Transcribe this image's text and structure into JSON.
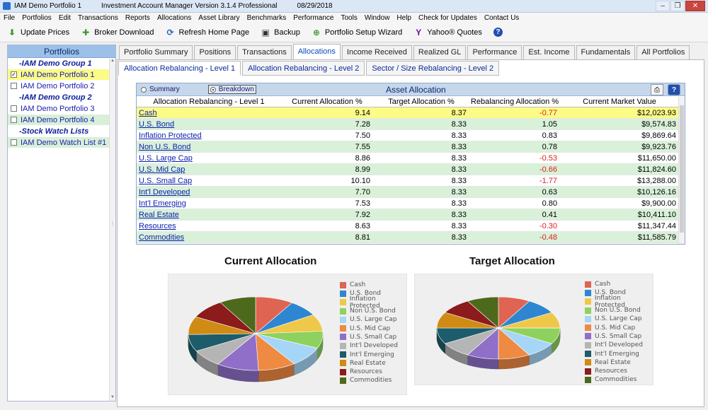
{
  "window": {
    "app_name": "IAM Demo Portfolio 1",
    "product": "Investment Account Manager Version 3.1.4 Professional",
    "date": "08/29/2018"
  },
  "menu": [
    "File",
    "Portfolios",
    "Edit",
    "Transactions",
    "Reports",
    "Allocations",
    "Asset Library",
    "Benchmarks",
    "Performance",
    "Tools",
    "Window",
    "Help",
    "Check for Updates",
    "Contact Us"
  ],
  "toolbar": {
    "update_prices": "Update Prices",
    "broker_download": "Broker Download",
    "refresh_home": "Refresh Home Page",
    "backup": "Backup",
    "setup_wizard": "Portfolio Setup Wizard",
    "yahoo_quotes": "Yahoo® Quotes"
  },
  "portfolios": {
    "title": "Portfolios",
    "items": [
      {
        "label": "-IAM Demo Group 1",
        "type": "group"
      },
      {
        "label": "IAM Demo Portfolio 1",
        "type": "item",
        "checked": true
      },
      {
        "label": "IAM Demo Portfolio 2",
        "type": "item",
        "checked": false
      },
      {
        "label": "-IAM Demo Group 2",
        "type": "group"
      },
      {
        "label": "IAM Demo Portfolio 3",
        "type": "item",
        "checked": false
      },
      {
        "label": "IAM Demo Portfolio 4",
        "type": "item",
        "checked": false
      },
      {
        "label": "-Stock Watch Lists",
        "type": "group"
      },
      {
        "label": "IAM Demo Watch List #1",
        "type": "item",
        "checked": false
      }
    ]
  },
  "main_tabs": [
    "Portfolio Summary",
    "Positions",
    "Transactions",
    "Allocations",
    "Income Received",
    "Realized GL",
    "Performance",
    "Est. Income",
    "Fundamentals",
    "All Portfolios"
  ],
  "sub_tabs": [
    "Allocation Rebalancing - Level 1",
    "Allocation Rebalancing - Level 2",
    "Sector / Size Rebalancing - Level 2"
  ],
  "asset_allocation": {
    "title": "Asset Allocation",
    "radio_summary": "Summary",
    "radio_breakdown": "Breakdown",
    "columns": [
      "Allocation Rebalancing - Level 1",
      "Current Allocation %",
      "Target Allocation %",
      "Rebalancing Allocation %",
      "Current Market Value"
    ],
    "rows": [
      {
        "name": "Cash",
        "current": "9.14",
        "target": "8.37",
        "rebal": "-0.77",
        "value": "$12,023.93"
      },
      {
        "name": "U.S. Bond",
        "current": "7.28",
        "target": "8.33",
        "rebal": "1.05",
        "value": "$9,574.83"
      },
      {
        "name": "Inflation Protected",
        "current": "7.50",
        "target": "8.33",
        "rebal": "0.83",
        "value": "$9,869.64"
      },
      {
        "name": "Non U.S. Bond",
        "current": "7.55",
        "target": "8.33",
        "rebal": "0.78",
        "value": "$9,923.76"
      },
      {
        "name": "U.S. Large Cap",
        "current": "8.86",
        "target": "8.33",
        "rebal": "-0.53",
        "value": "$11,650.00"
      },
      {
        "name": "U.S. Mid Cap",
        "current": "8.99",
        "target": "8.33",
        "rebal": "-0.66",
        "value": "$11,824.60"
      },
      {
        "name": "U.S. Small Cap",
        "current": "10.10",
        "target": "8.33",
        "rebal": "-1.77",
        "value": "$13,288.00"
      },
      {
        "name": "Int'l Developed",
        "current": "7.70",
        "target": "8.33",
        "rebal": "0.63",
        "value": "$10,126.16"
      },
      {
        "name": "Int'l Emerging",
        "current": "7.53",
        "target": "8.33",
        "rebal": "0.80",
        "value": "$9,900.00"
      },
      {
        "name": "Real Estate",
        "current": "7.92",
        "target": "8.33",
        "rebal": "0.41",
        "value": "$10,411.10"
      },
      {
        "name": "Resources",
        "current": "8.63",
        "target": "8.33",
        "rebal": "-0.30",
        "value": "$11,347.44"
      },
      {
        "name": "Commodities",
        "current": "8.81",
        "target": "8.33",
        "rebal": "-0.48",
        "value": "$11,585.79"
      }
    ]
  },
  "chart_data": [
    {
      "type": "pie",
      "title": "Current Allocation",
      "categories": [
        "Cash",
        "U.S. Bond",
        "Inflation Protected",
        "Non U.S. Bond",
        "U.S. Large Cap",
        "U.S. Mid Cap",
        "U.S. Small Cap",
        "Int'l Developed",
        "Int'l Emerging",
        "Real Estate",
        "Resources",
        "Commodities"
      ],
      "values": [
        9.14,
        7.28,
        7.5,
        7.55,
        8.86,
        8.99,
        10.1,
        7.7,
        7.53,
        7.92,
        8.63,
        8.81
      ],
      "colors": [
        "#e06452",
        "#2f86d0",
        "#efc84a",
        "#8fd15e",
        "#a5d6f7",
        "#ef8a43",
        "#8f6fc8",
        "#b5b5b5",
        "#1d5c6a",
        "#d08b14",
        "#8c1b1b",
        "#4d6a1c"
      ],
      "legend": "right"
    },
    {
      "type": "pie",
      "title": "Target Allocation",
      "categories": [
        "Cash",
        "U.S. Bond",
        "Inflation Protected",
        "Non U.S. Bond",
        "U.S. Large Cap",
        "U.S. Mid Cap",
        "U.S. Small Cap",
        "Int'l Developed",
        "Int'l Emerging",
        "Real Estate",
        "Resources",
        "Commodities"
      ],
      "values": [
        8.37,
        8.33,
        8.33,
        8.33,
        8.33,
        8.33,
        8.33,
        8.33,
        8.33,
        8.33,
        8.33,
        8.33
      ],
      "colors": [
        "#e06452",
        "#2f86d0",
        "#efc84a",
        "#8fd15e",
        "#a5d6f7",
        "#ef8a43",
        "#8f6fc8",
        "#b5b5b5",
        "#1d5c6a",
        "#d08b14",
        "#8c1b1b",
        "#4d6a1c"
      ],
      "legend": "right"
    }
  ]
}
